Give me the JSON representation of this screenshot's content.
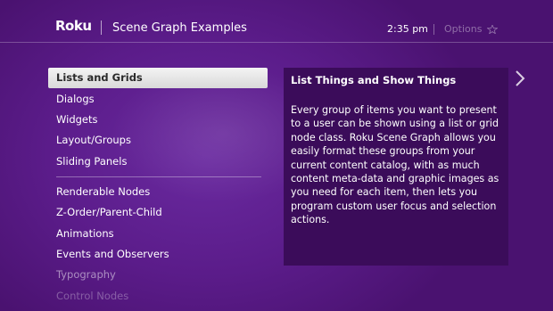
{
  "header": {
    "logo": "Roku",
    "title": "Scene Graph Examples",
    "time": "2:35 pm",
    "options_label": "Options",
    "options_icon": "star-icon"
  },
  "menu": {
    "items": [
      {
        "label": "Lists and Grids",
        "state": "selected"
      },
      {
        "label": "Dialogs"
      },
      {
        "label": "Widgets"
      },
      {
        "label": "Layout/Groups"
      },
      {
        "label": "Sliding Panels"
      },
      {
        "label": "Renderable Nodes"
      },
      {
        "label": "Z-Order/Parent-Child"
      },
      {
        "label": "Animations"
      },
      {
        "label": "Events and Observers"
      },
      {
        "label": "Typography"
      },
      {
        "label": "Control Nodes"
      }
    ]
  },
  "panel": {
    "title": "List Things and Show Things",
    "body": "Every group of items you want to present to a user can be shown using a list or grid node class. Roku Scene Graph allows you easily format these groups from your current content catalog, with as much content meta-data and graphic images as you need for each item, then lets you program custom user focus and selection actions."
  },
  "icons": {
    "next_arrow": "chevron-right-icon"
  },
  "colors": {
    "background": "#5a1a86",
    "panel": "#3b0c5a",
    "selected_item": "#e8e8e8"
  }
}
